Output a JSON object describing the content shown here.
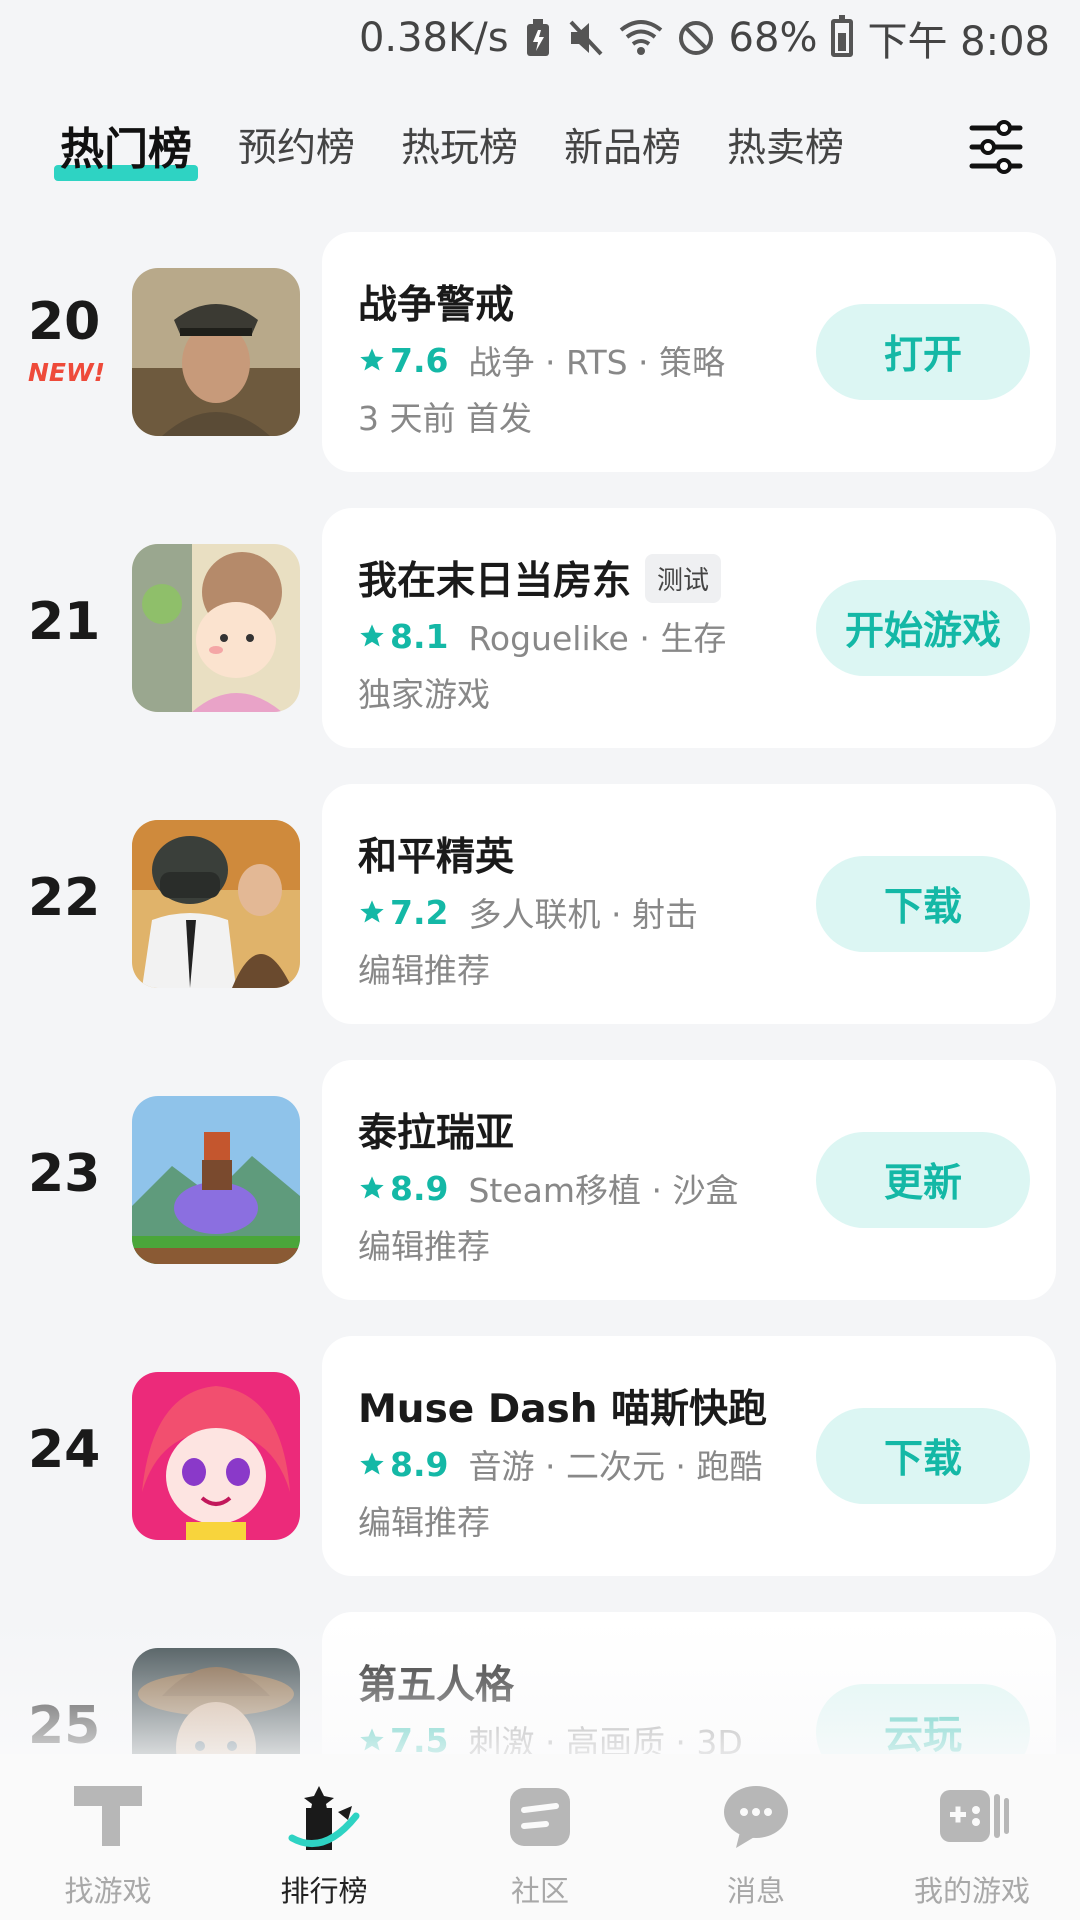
{
  "status_bar": {
    "speed": "0.38K/s",
    "battery": "68%",
    "time": "下午 8:08"
  },
  "tabs": [
    {
      "label": "热门榜",
      "active": true
    },
    {
      "label": "预约榜",
      "active": false
    },
    {
      "label": "热玩榜",
      "active": false
    },
    {
      "label": "新品榜",
      "active": false
    },
    {
      "label": "热卖榜",
      "active": false
    }
  ],
  "games": [
    {
      "rank": "20",
      "badge": "NEW!",
      "title": "战争警戒",
      "tag": "",
      "rating": "7.6",
      "tags": "战争 · RTS · 策略",
      "sub": "3 天前 首发",
      "action": "打开"
    },
    {
      "rank": "21",
      "badge": "",
      "title": "我在末日当房东",
      "tag": "测试",
      "rating": "8.1",
      "tags": "Roguelike · 生存",
      "sub": "独家游戏",
      "action": "开始游戏"
    },
    {
      "rank": "22",
      "badge": "",
      "title": "和平精英",
      "tag": "",
      "rating": "7.2",
      "tags": "多人联机 · 射击",
      "sub": "编辑推荐",
      "action": "下载"
    },
    {
      "rank": "23",
      "badge": "",
      "title": "泰拉瑞亚",
      "tag": "",
      "rating": "8.9",
      "tags": "Steam移植 · 沙盒",
      "sub": "编辑推荐",
      "action": "更新"
    },
    {
      "rank": "24",
      "badge": "",
      "title": "Muse Dash 喵斯快跑",
      "tag": "",
      "rating": "8.9",
      "tags": "音游 · 二次元 · 跑酷",
      "sub": "编辑推荐",
      "action": "下载"
    },
    {
      "rank": "25",
      "badge": "",
      "title": "第五人格",
      "tag": "",
      "rating": "7.5",
      "tags": "刺激 · 高画质 · 3D",
      "sub": "",
      "action": "云玩"
    }
  ],
  "bottom_nav": [
    {
      "label": "找游戏",
      "active": false,
      "icon": "find-games-icon"
    },
    {
      "label": "排行榜",
      "active": true,
      "icon": "ranking-icon"
    },
    {
      "label": "社区",
      "active": false,
      "icon": "community-icon"
    },
    {
      "label": "消息",
      "active": false,
      "icon": "message-icon"
    },
    {
      "label": "我的游戏",
      "active": false,
      "icon": "my-games-icon"
    }
  ],
  "colors": {
    "accent": "#14b8a6",
    "accent_bg": "#dcf6f3",
    "new_badge": "#ee4a3a",
    "background": "#f4f5f7"
  }
}
